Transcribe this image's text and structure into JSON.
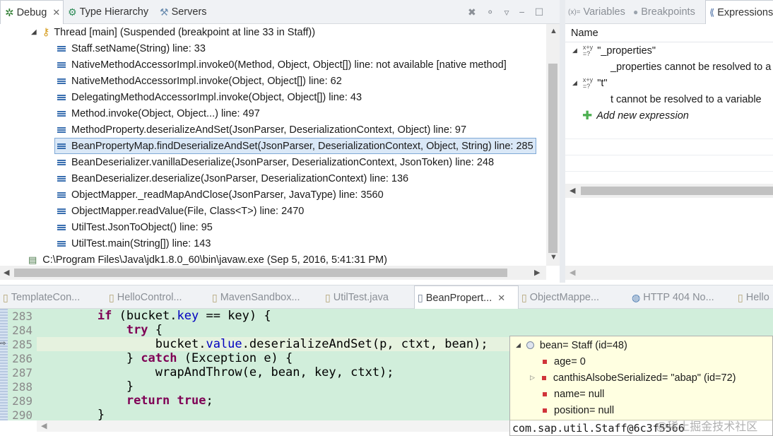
{
  "debug_view": {
    "tabs": [
      {
        "label": "Debug",
        "icon": "debug-bug-icon"
      },
      {
        "label": "Type Hierarchy",
        "icon": "hierarchy-icon"
      },
      {
        "label": "Servers",
        "icon": "servers-icon"
      }
    ],
    "thread_label": "Thread [main] (Suspended (breakpoint at line 33 in Staff))",
    "frames": [
      "Staff.setName(String) line: 33",
      "NativeMethodAccessorImpl.invoke0(Method, Object, Object[]) line: not available [native method]",
      "NativeMethodAccessorImpl.invoke(Object, Object[]) line: 62",
      "DelegatingMethodAccessorImpl.invoke(Object, Object[]) line: 43",
      "Method.invoke(Object, Object...) line: 497",
      "MethodProperty.deserializeAndSet(JsonParser, DeserializationContext, Object) line: 97",
      "BeanPropertyMap.findDeserializeAndSet(JsonParser, DeserializationContext, Object, String) line: 285",
      "BeanDeserializer.vanillaDeserialize(JsonParser, DeserializationContext, JsonToken) line: 248",
      "BeanDeserializer.deserialize(JsonParser, DeserializationContext) line: 136",
      "ObjectMapper._readMapAndClose(JsonParser, JavaType) line: 3560",
      "ObjectMapper.readValue(File, Class<T>) line: 2470",
      "UtilTest.JsonToObject() line: 95",
      "UtilTest.main(String[]) line: 143"
    ],
    "selected_frame_index": 6,
    "process_label": "C:\\Program Files\\Java\\jdk1.8.0_60\\bin\\javaw.exe (Sep 5, 2016, 5:41:31 PM)"
  },
  "right_view": {
    "tabs": [
      {
        "label": "Variables",
        "prefix": "(x)="
      },
      {
        "label": "Breakpoints",
        "prefix": ""
      },
      {
        "label": "Expressions",
        "prefix": ""
      }
    ],
    "column_header": "Name",
    "expressions": [
      {
        "name": "\"_properties\"",
        "error": "_properties cannot be resolved to a"
      },
      {
        "name": "\"t\"",
        "error": "t cannot be resolved to a variable"
      }
    ],
    "add_new_label": "Add new expression"
  },
  "editor_tabs": [
    {
      "label": "TemplateCon...",
      "active": false
    },
    {
      "label": "HelloControl...",
      "active": false
    },
    {
      "label": "MavenSandbox...",
      "active": false
    },
    {
      "label": "UtilTest.java",
      "active": false
    },
    {
      "label": "BeanPropert...",
      "active": true
    },
    {
      "label": "ObjectMappe...",
      "active": false
    },
    {
      "label": "HTTP 404 No...",
      "active": false
    },
    {
      "label": "Hello",
      "active": false
    }
  ],
  "code": {
    "line_numbers": [
      "283",
      "284",
      "285",
      "286",
      "287",
      "288",
      "289",
      "290"
    ],
    "tokens": {
      "if": "if",
      "try": "try",
      "catch": "catch",
      "return": "return",
      "true": "true",
      "bucket": "bucket",
      "key_field": "key",
      "value_field": "value",
      "l283_a": "        ",
      "l283_b": " (",
      "l283_c": ".",
      "l283_d": " == key) {",
      "l284_b": " {",
      "l285_a": "            ",
      "l285_b": ".",
      "l285_c": ".deserializeAndSet(p, ctxt, bean);",
      "l286_a": "        } ",
      "l286_b": " (Exception e) {",
      "l287": "            wrapAndThrow(e, bean, key, ctxt);",
      "l288": "        }",
      "l289_b": ";",
      "l290": "    }"
    }
  },
  "hover": {
    "root": "bean= Staff  (id=48)",
    "fields": [
      "age= 0",
      "canthisAlsobeSerialized= \"abap\" (id=72)",
      "name= null",
      "position= null"
    ],
    "detail": "com.sap.util.Staff@6c3f5566"
  },
  "watermark": "@稀土掘金技术社区",
  "colors": {
    "editor_bg": "#d1eedb",
    "current_line": "#e6f2df",
    "hover_bg": "#ffffe1",
    "selection": "#dae8f7",
    "keyword": "#7f0055",
    "field": "#0000c0"
  }
}
